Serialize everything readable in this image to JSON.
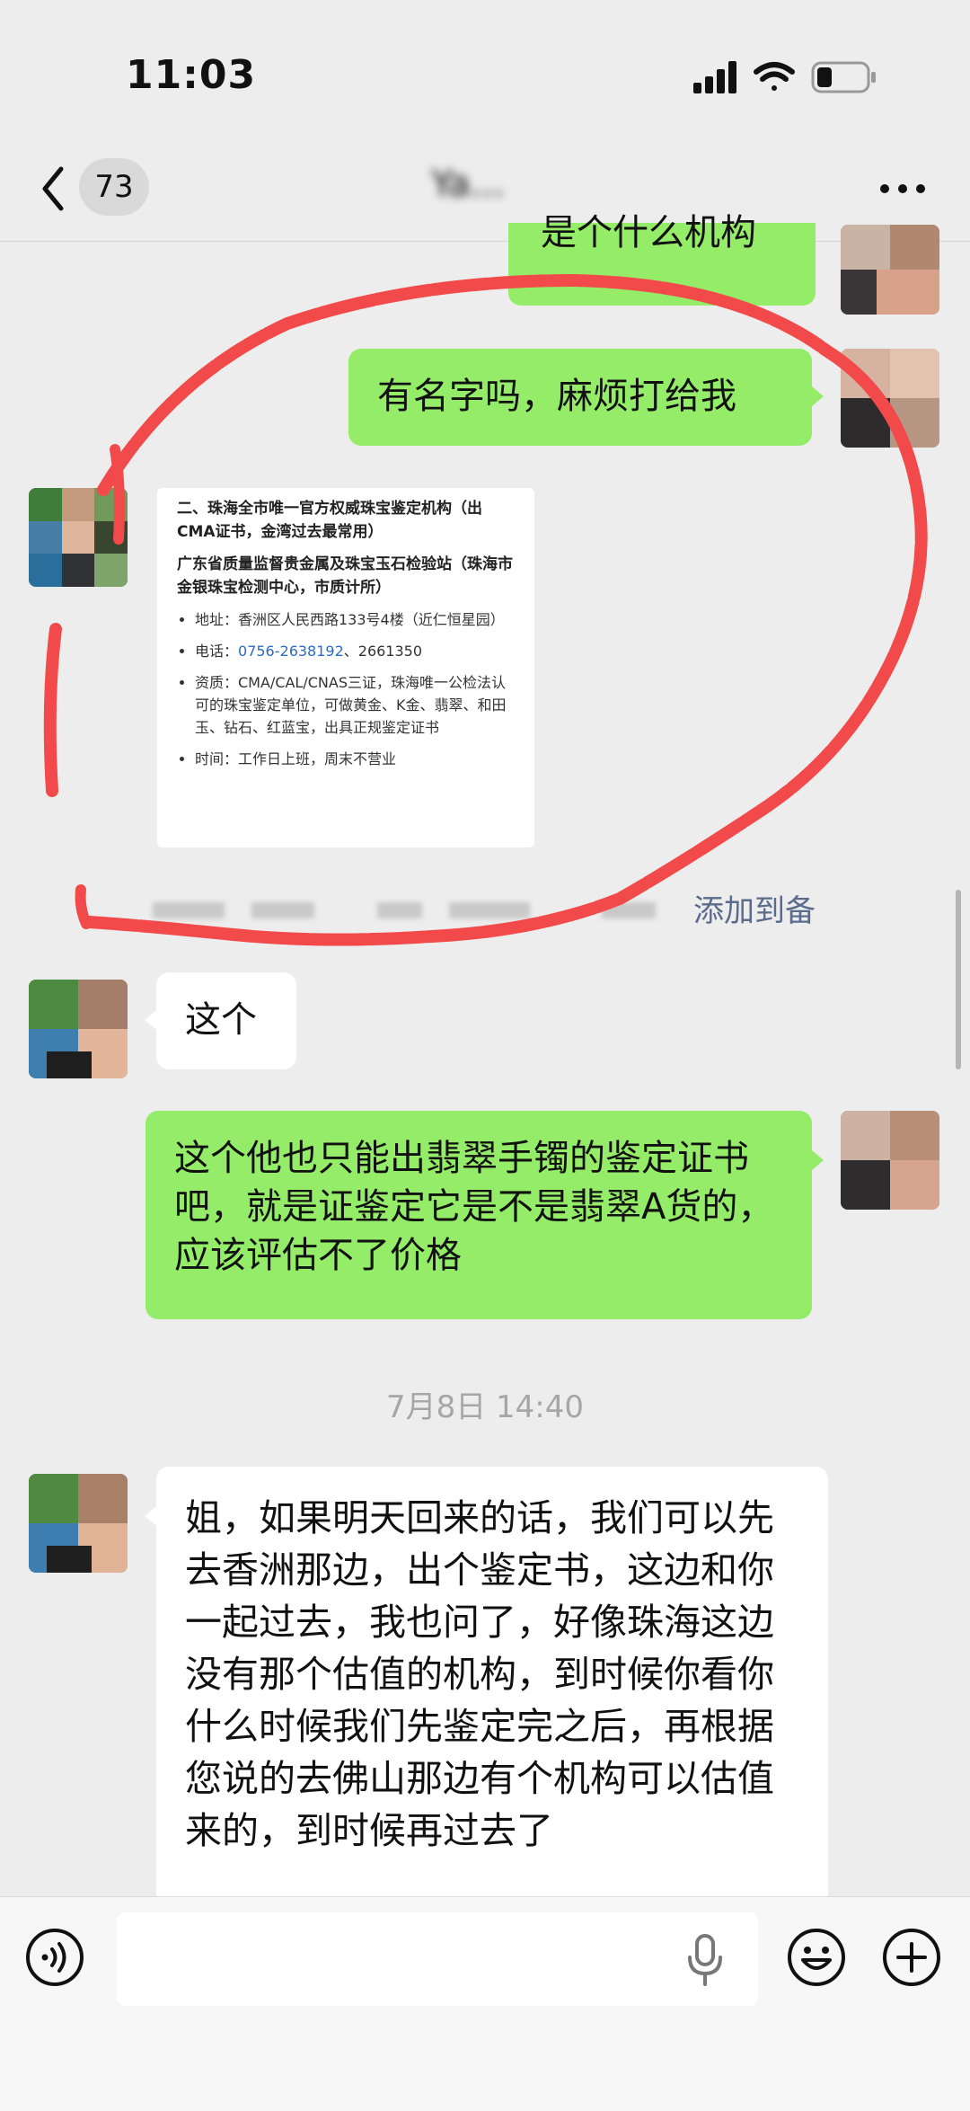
{
  "status_bar": {
    "time": "11:03"
  },
  "nav": {
    "unread_count": "73",
    "title": "Ya..."
  },
  "messages": {
    "m1": "是个什么机构",
    "m2": "有名字吗，麻烦打给我",
    "card": {
      "heading1": "二、珠海全市唯一官方权威珠宝鉴定机构（出CMA证书，金湾过去最常用）",
      "heading2": "广东省质量监督贵金属及珠宝玉石检验站（珠海市金银珠宝检测中心，市质计所）",
      "address": "地址：香洲区人民西路133号4楼（近仁恒星园）",
      "phone_label": "电话：",
      "phone1": "0756-2638192",
      "phone2": "、2661350",
      "qualification": "资质：CMA/CAL/CNAS三证，珠海唯一公检法认可的珠宝鉴定单位，可做黄金、K金、翡翠、和田玉、钻石、红蓝宝，出具正规鉴定证书",
      "hours": "时间：工作日上班，周末不营业"
    },
    "add_to": "添加到备",
    "m3": "这个",
    "m4": "这个他也只能出翡翠手镯的鉴定证书吧，就是证鉴定它是不是翡翠A货的，应该评估不了价格",
    "timestamp": "7月8日 14:40",
    "m5": "姐，如果明天回来的话，我们可以先去香洲那边，出个鉴定书，这边和你一起过去，我也问了，好像珠海这边没有那个估值的机构，到时候你看你什么时候我们先鉴定完之后，再根据您说的去佛山那边有个机构可以估值来的，到时候再过去了"
  },
  "input": {
    "placeholder": ""
  },
  "icons": {
    "back": "chevron-left-icon",
    "more": "more-dots-icon",
    "voice": "voice-icon",
    "mic": "mic-icon",
    "emoji": "emoji-icon",
    "plus": "plus-icon",
    "signal": "signal-icon",
    "wifi": "wifi-icon",
    "battery": "battery-icon"
  },
  "colors": {
    "bubble_green": "#95ec69",
    "bubble_white": "#ffffff",
    "background": "#ededed",
    "annotation_red": "#f24a4a"
  }
}
